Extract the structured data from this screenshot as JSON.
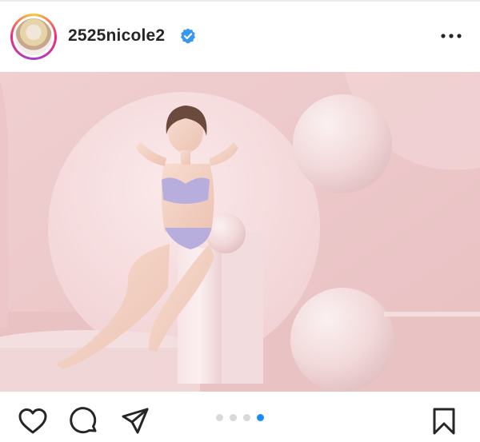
{
  "post": {
    "username": "2525nicole2",
    "verified": true,
    "carousel": {
      "count": 4,
      "active_index": 3
    }
  },
  "icons": {
    "verified": "verified-badge-icon",
    "more": "more-options-icon",
    "like": "heart-icon",
    "comment": "comment-icon",
    "share": "paper-plane-icon",
    "save": "bookmark-icon"
  },
  "colors": {
    "text": "#262626",
    "verified_blue": "#3897f0",
    "active_dot": "#1a8cff",
    "inactive_dot": "#d9d9d9"
  }
}
